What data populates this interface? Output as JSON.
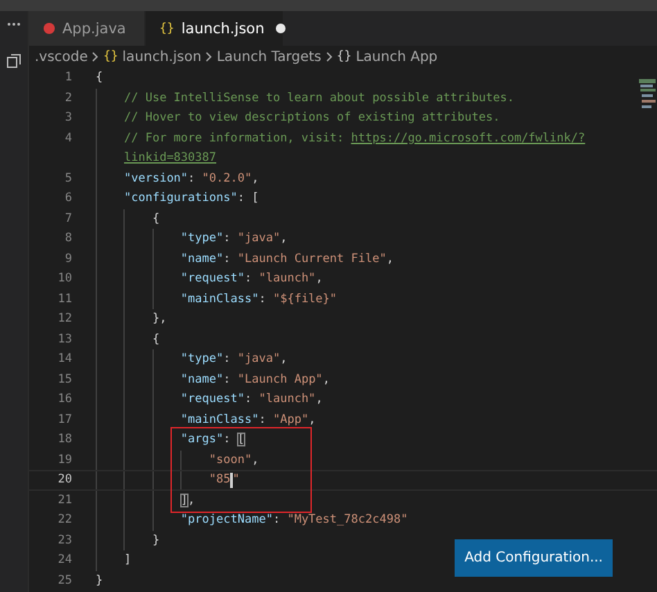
{
  "tabs": [
    {
      "label": "App.java",
      "kind": "java",
      "selected": false,
      "modified": false
    },
    {
      "label": "launch.json",
      "kind": "json",
      "icon": "{}",
      "selected": true,
      "modified": true
    }
  ],
  "breadcrumb": [
    {
      "label": ".vscode",
      "kind": "folder"
    },
    {
      "label": "launch.json",
      "kind": "json",
      "icon": "{}"
    },
    {
      "label": "Launch Targets",
      "kind": "folder"
    },
    {
      "label": "Launch App",
      "kind": "object",
      "icon": "{}"
    }
  ],
  "lines": [
    {
      "number": "1",
      "tokens": [
        {
          "kind": "punct",
          "text": "{"
        }
      ]
    },
    {
      "number": "2",
      "tokens": [
        {
          "kind": "comment",
          "text": "    // Use IntelliSense to learn about possible attributes."
        }
      ]
    },
    {
      "number": "3",
      "tokens": [
        {
          "kind": "comment",
          "text": "    // Hover to view descriptions of existing attributes."
        }
      ]
    },
    {
      "number": "4",
      "tokens": [
        {
          "kind": "comment",
          "text": "    // For more information, visit: "
        },
        {
          "kind": "link",
          "text": "https://go.microsoft.com/fwlink/?"
        }
      ]
    },
    {
      "tokens": [
        {
          "kind": "link",
          "text": "    linkid=830387"
        }
      ]
    },
    {
      "number": "5",
      "tokens": [
        {
          "kind": "key",
          "text": "    \"version\""
        },
        {
          "kind": "punct",
          "text": ": "
        },
        {
          "kind": "string",
          "text": "\"0.2.0\""
        },
        {
          "kind": "punct",
          "text": ","
        }
      ]
    },
    {
      "number": "6",
      "tokens": [
        {
          "kind": "key",
          "text": "    \"configurations\""
        },
        {
          "kind": "punct",
          "text": ": ["
        }
      ]
    },
    {
      "number": "7",
      "tokens": [
        {
          "kind": "punct",
          "text": "        {"
        }
      ]
    },
    {
      "number": "8",
      "tokens": [
        {
          "kind": "key",
          "text": "            \"type\""
        },
        {
          "kind": "punct",
          "text": ": "
        },
        {
          "kind": "string",
          "text": "\"java\""
        },
        {
          "kind": "punct",
          "text": ","
        }
      ]
    },
    {
      "number": "9",
      "tokens": [
        {
          "kind": "key",
          "text": "            \"name\""
        },
        {
          "kind": "punct",
          "text": ": "
        },
        {
          "kind": "string",
          "text": "\"Launch Current File\""
        },
        {
          "kind": "punct",
          "text": ","
        }
      ]
    },
    {
      "number": "10",
      "tokens": [
        {
          "kind": "key",
          "text": "            \"request\""
        },
        {
          "kind": "punct",
          "text": ": "
        },
        {
          "kind": "string",
          "text": "\"launch\""
        },
        {
          "kind": "punct",
          "text": ","
        }
      ]
    },
    {
      "number": "11",
      "tokens": [
        {
          "kind": "key",
          "text": "            \"mainClass\""
        },
        {
          "kind": "punct",
          "text": ": "
        },
        {
          "kind": "string",
          "text": "\"${file}\""
        }
      ]
    },
    {
      "number": "12",
      "tokens": [
        {
          "kind": "punct",
          "text": "        },"
        }
      ]
    },
    {
      "number": "13",
      "tokens": [
        {
          "kind": "punct",
          "text": "        {"
        }
      ]
    },
    {
      "number": "14",
      "tokens": [
        {
          "kind": "key",
          "text": "            \"type\""
        },
        {
          "kind": "punct",
          "text": ": "
        },
        {
          "kind": "string",
          "text": "\"java\""
        },
        {
          "kind": "punct",
          "text": ","
        }
      ]
    },
    {
      "number": "15",
      "tokens": [
        {
          "kind": "key",
          "text": "            \"name\""
        },
        {
          "kind": "punct",
          "text": ": "
        },
        {
          "kind": "string",
          "text": "\"Launch App\""
        },
        {
          "kind": "punct",
          "text": ","
        }
      ]
    },
    {
      "number": "16",
      "tokens": [
        {
          "kind": "key",
          "text": "            \"request\""
        },
        {
          "kind": "punct",
          "text": ": "
        },
        {
          "kind": "string",
          "text": "\"launch\""
        },
        {
          "kind": "punct",
          "text": ","
        }
      ]
    },
    {
      "number": "17",
      "tokens": [
        {
          "kind": "key",
          "text": "            \"mainClass\""
        },
        {
          "kind": "punct",
          "text": ": "
        },
        {
          "kind": "string",
          "text": "\"App\""
        },
        {
          "kind": "punct",
          "text": ","
        }
      ]
    },
    {
      "number": "18",
      "boxed": true,
      "tokens": [
        {
          "kind": "key",
          "text": "            \"args\""
        },
        {
          "kind": "punct",
          "text": ": "
        },
        {
          "kind": "bracket-match",
          "text": "["
        }
      ]
    },
    {
      "number": "19",
      "boxed": true,
      "tokens": [
        {
          "kind": "string",
          "text": "                \"soon\""
        },
        {
          "kind": "punct",
          "text": ","
        }
      ]
    },
    {
      "number": "20",
      "boxed": true,
      "current": true,
      "tokens": [
        {
          "kind": "string",
          "text": "                \"85"
        },
        {
          "kind": "cursor"
        },
        {
          "kind": "string",
          "text": "\""
        }
      ]
    },
    {
      "number": "21",
      "boxed": true,
      "tokens": [
        {
          "kind": "bracket-match",
          "text": "            ]"
        },
        {
          "kind": "punct",
          "text": ","
        }
      ]
    },
    {
      "number": "22",
      "tokens": [
        {
          "kind": "key",
          "text": "            \"projectName\""
        },
        {
          "kind": "punct",
          "text": ": "
        },
        {
          "kind": "string",
          "text": "\"MyTest_78c2c498\""
        }
      ]
    },
    {
      "number": "23",
      "tokens": [
        {
          "kind": "punct",
          "text": "        }"
        }
      ]
    },
    {
      "number": "24",
      "tokens": [
        {
          "kind": "punct",
          "text": "    ]"
        }
      ]
    },
    {
      "number": "25",
      "tokens": [
        {
          "kind": "punct",
          "text": "}"
        }
      ]
    }
  ],
  "annotation": {
    "color": "#e0262a"
  },
  "button": {
    "label": "Add Configuration..."
  }
}
